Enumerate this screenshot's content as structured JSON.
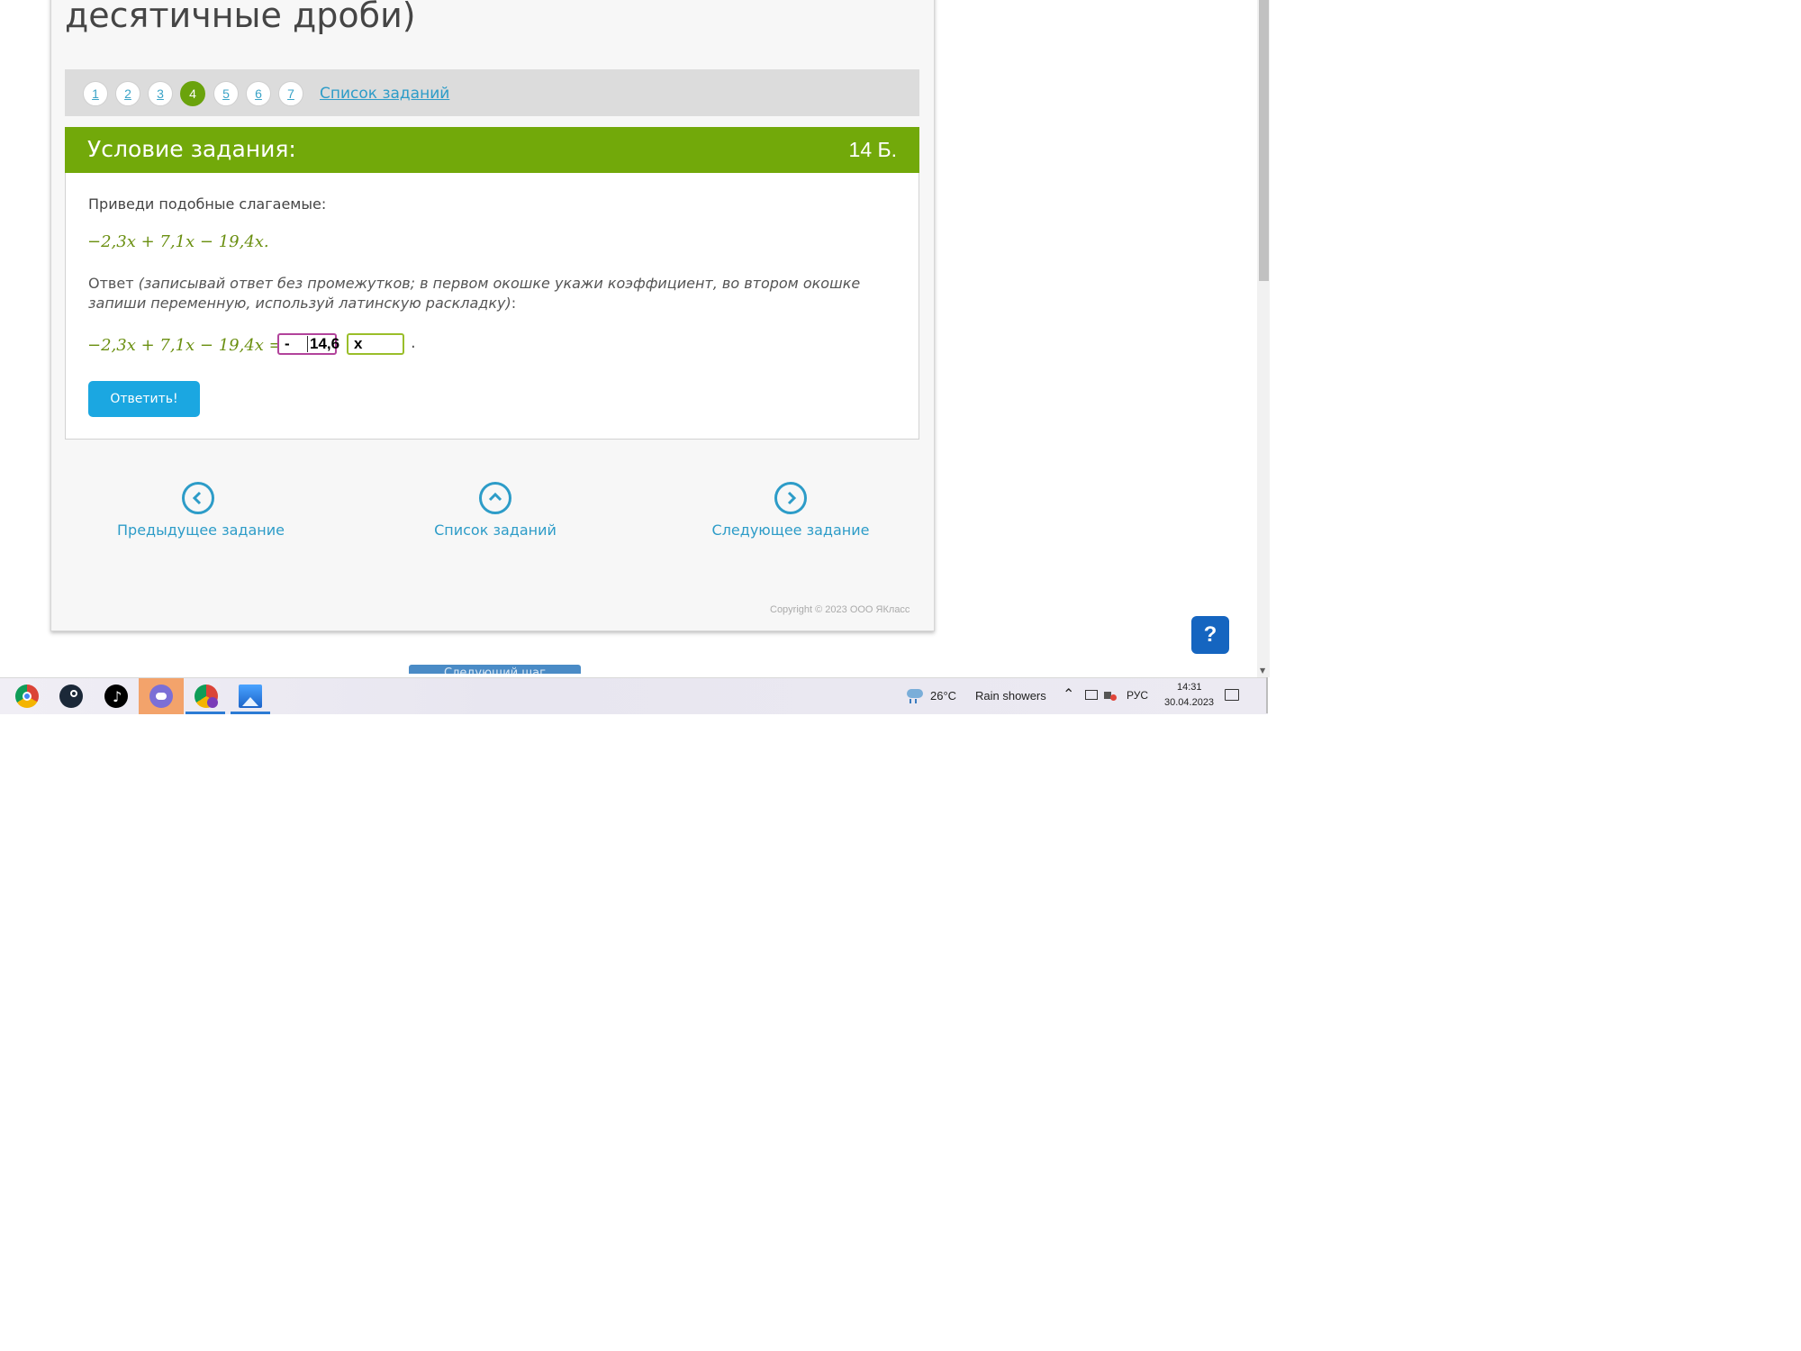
{
  "page": {
    "heading_line1": "десятичные дроби)",
    "colors": {
      "accent_green": "#72a90a",
      "link_blue": "#2d9cc8",
      "submit_blue": "#1ba7e1"
    }
  },
  "task_nav": {
    "numbers": [
      "1",
      "2",
      "3",
      "4",
      "5",
      "6",
      "7"
    ],
    "active": "4",
    "list_link": "Список заданий"
  },
  "condition": {
    "title": "Условие задания:",
    "points": "14 Б.",
    "prompt": "Приведи подобные слагаемые:",
    "expression": "−2,3x + 7,1x − 19,4x.",
    "answer_label": "Ответ",
    "answer_hint": "(записывай ответ без промежутков; в первом окошке укажи коэффициент, во втором окошке запиши переменную, используй латинскую раскладку)",
    "answer_colon": ":",
    "answer_expression": "−2,3x + 7,1x − 19,4x =",
    "box1_value_sign": "-",
    "box1_value_number": "14,6",
    "box2_value": "x",
    "trailing_dot": ".",
    "submit_label": "Ответить!"
  },
  "bottom_nav": {
    "prev_label": "Предыдущее задание",
    "list_label": "Список заданий",
    "next_label": "Следующее задание"
  },
  "footer": {
    "copyright": "Copyright © 2023 ООО ЯКласс",
    "next_step": "Следующий шаг"
  },
  "help": {
    "label": "?"
  },
  "taskbar": {
    "apps": [
      "chrome-icon",
      "steam-icon",
      "tiktok-icon",
      "discord-icon",
      "chrome-profile-icon",
      "photos-icon"
    ],
    "weather_temp": "26°C",
    "weather_text": "Rain showers",
    "language": "РУС",
    "time": "14:31",
    "date": "30.04.2023"
  }
}
